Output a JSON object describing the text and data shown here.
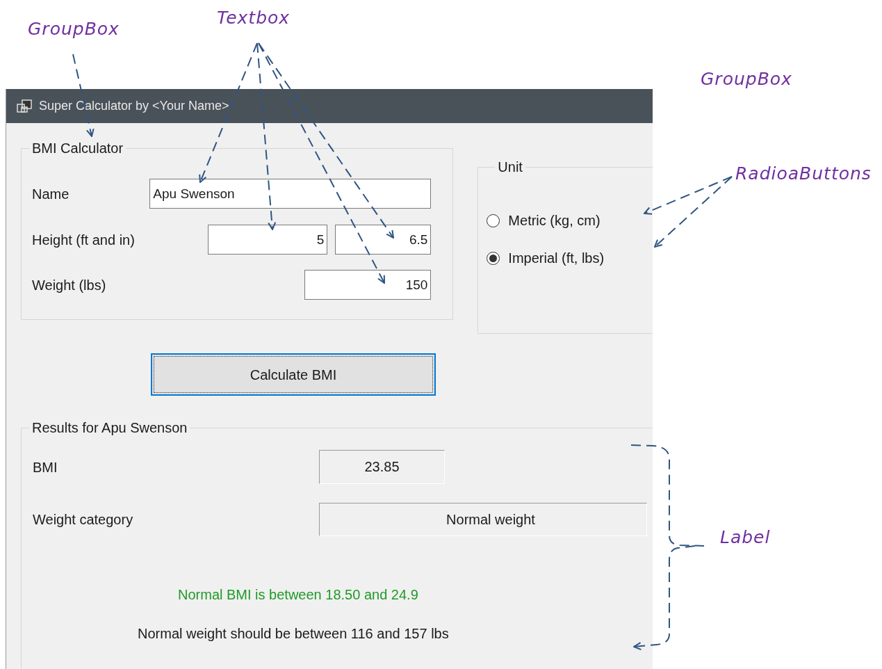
{
  "annotations": [
    {
      "label": "GroupBox"
    },
    {
      "label": "Textbox"
    },
    {
      "label": "GroupBox"
    },
    {
      "label": "RadioaButtons"
    },
    {
      "label": "Label"
    }
  ],
  "window": {
    "title": "Super Calculator by <Your Name>"
  },
  "bmi_group": {
    "title": "BMI Calculator",
    "fields": [
      {
        "label": "Name",
        "values": [
          "Apu Swenson"
        ]
      },
      {
        "label": "Height (ft and in)",
        "values": [
          "5",
          "6.5"
        ]
      },
      {
        "label": "Weight (lbs)",
        "values": [
          "150"
        ]
      }
    ]
  },
  "unit_group": {
    "title": "Unit",
    "options": [
      {
        "label": "Metric (kg, cm)",
        "selected": false
      },
      {
        "label": "Imperial (ft, lbs)",
        "selected": true
      }
    ]
  },
  "calculate_button": "Calculate BMI",
  "results": {
    "title": "Results for Apu Swenson",
    "rows": [
      {
        "label": "BMI",
        "value": "23.85"
      },
      {
        "label": "Weight category",
        "value": "Normal weight"
      }
    ],
    "note": "Normal BMI is between 18.50 and 24.9",
    "range": "Normal weight should be between 116 and 157 lbs"
  }
}
